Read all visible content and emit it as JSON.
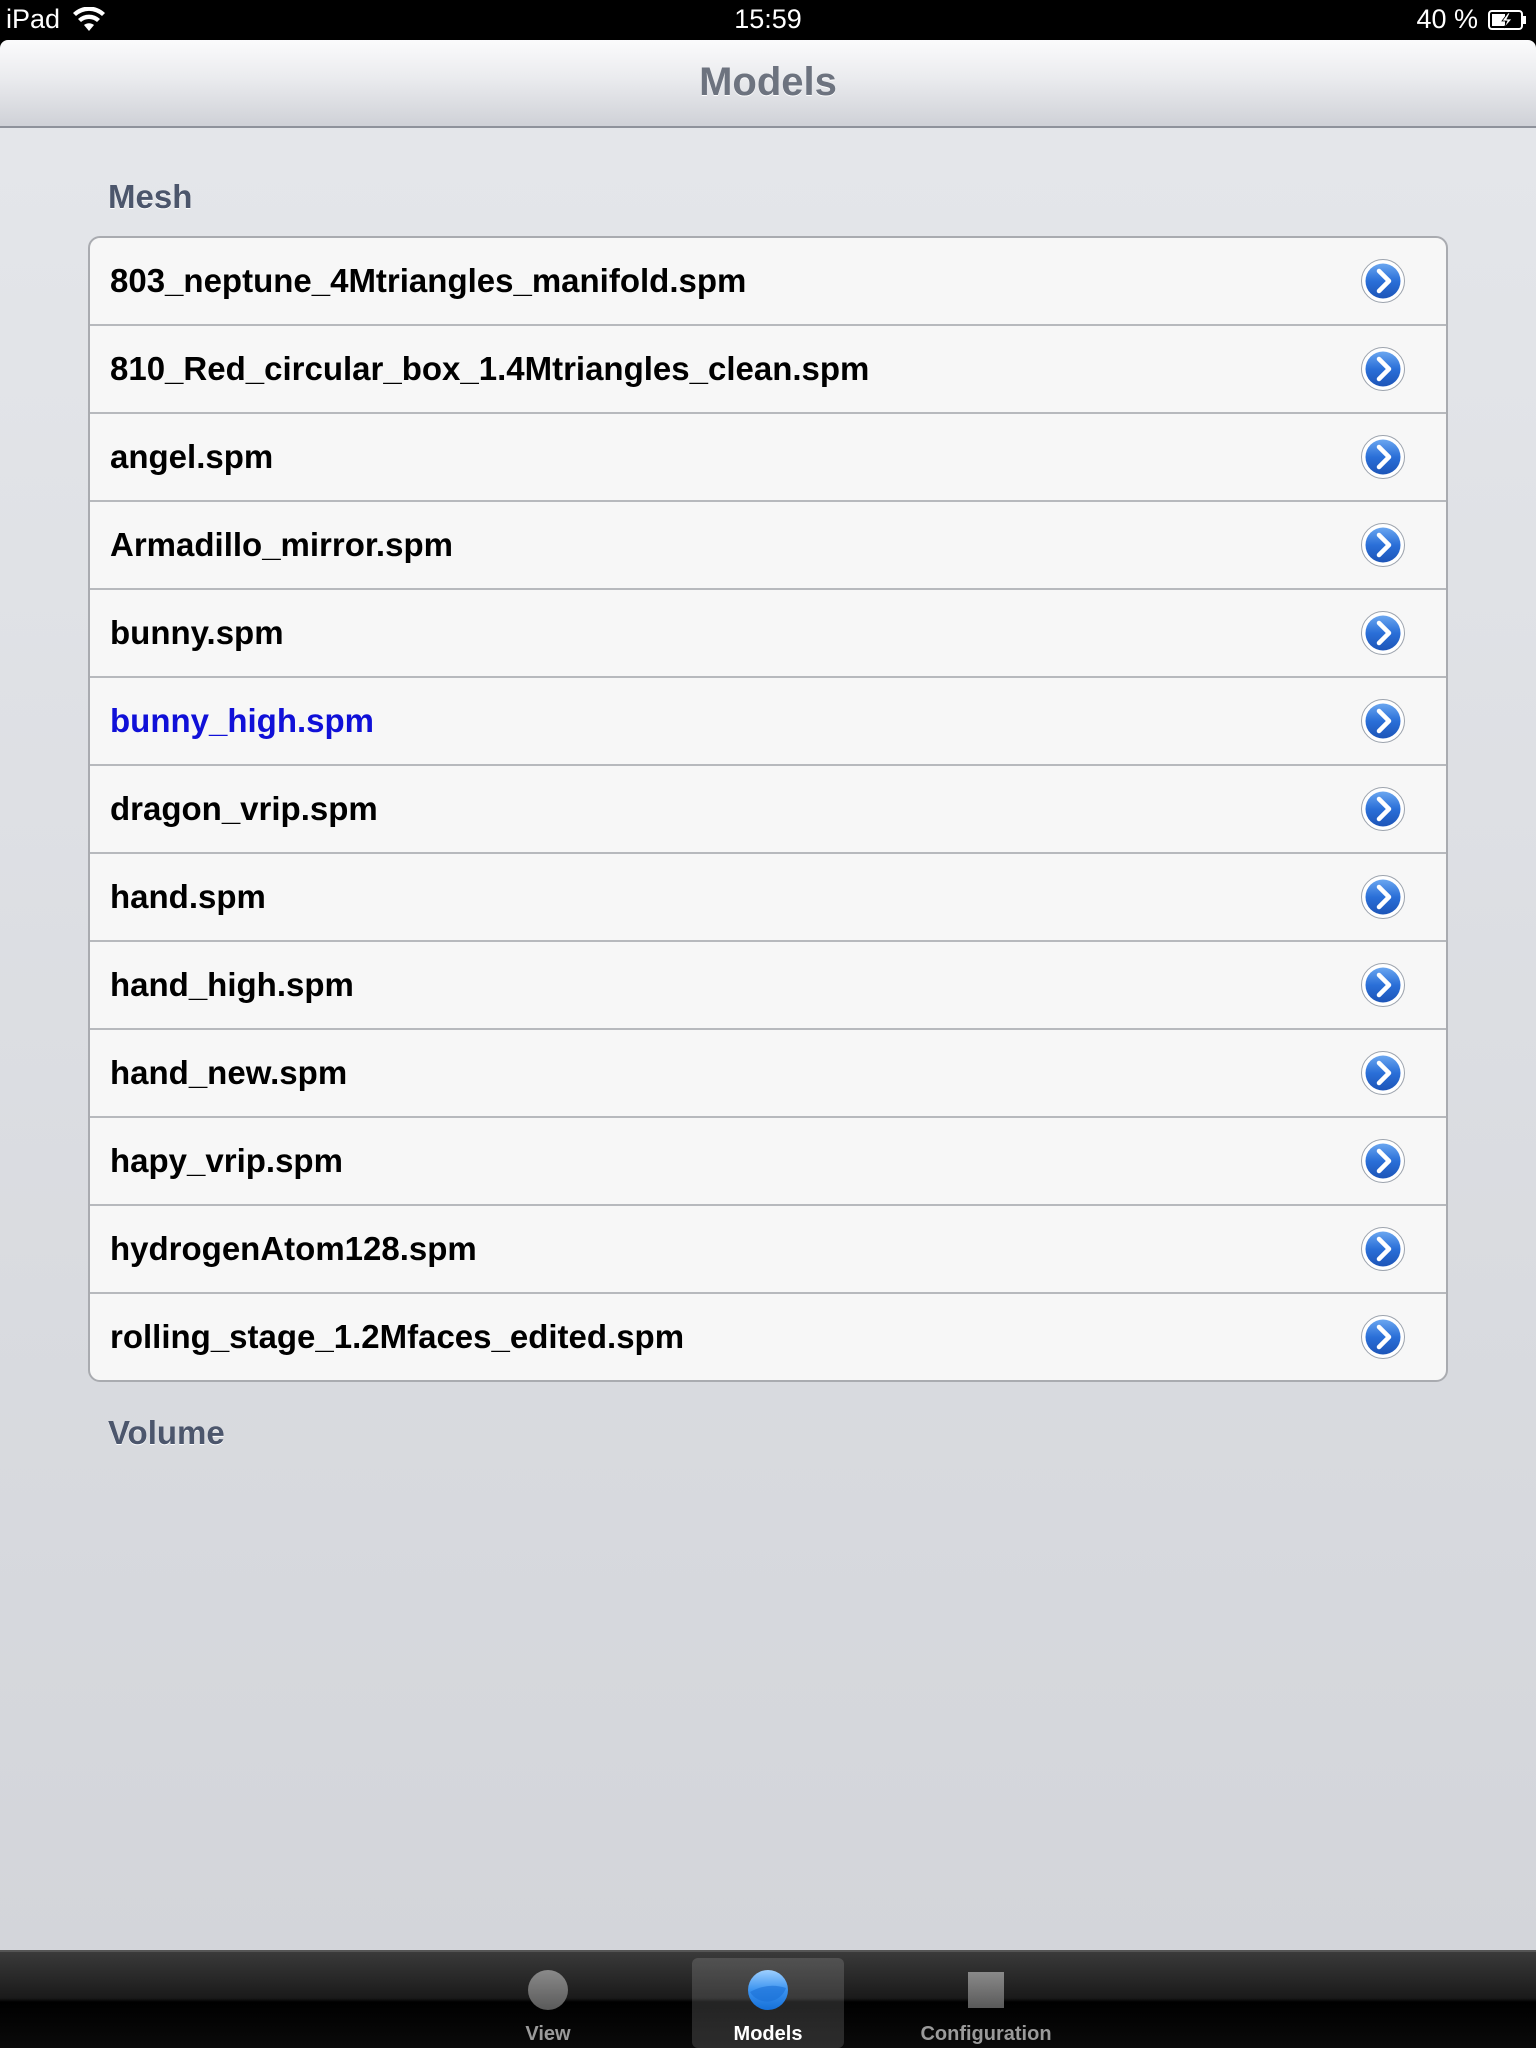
{
  "status_bar": {
    "device": "iPad",
    "time": "15:59",
    "battery": "40 %"
  },
  "nav_bar": {
    "title": "Models"
  },
  "sections": {
    "mesh": {
      "header": "Mesh",
      "items": [
        {
          "label": "803_neptune_4Mtriangles_manifold.spm"
        },
        {
          "label": "810_Red_circular_box_1.4Mtriangles_clean.spm"
        },
        {
          "label": "angel.spm"
        },
        {
          "label": "Armadillo_mirror.spm"
        },
        {
          "label": "bunny.spm"
        },
        {
          "label": "bunny_high.spm",
          "selected": true
        },
        {
          "label": "dragon_vrip.spm"
        },
        {
          "label": "hand.spm"
        },
        {
          "label": "hand_high.spm"
        },
        {
          "label": "hand_new.spm"
        },
        {
          "label": "hapy_vrip.spm"
        },
        {
          "label": "hydrogenAtom128.spm"
        },
        {
          "label": "rolling_stage_1.2Mfaces_edited.spm"
        }
      ]
    },
    "volume": {
      "header": "Volume"
    }
  },
  "tab_bar": {
    "tabs": [
      {
        "label": "View",
        "icon": "circle-icon"
      },
      {
        "label": "Models",
        "icon": "blue-circle-icon",
        "active": true
      },
      {
        "label": "Configuration",
        "icon": "square-icon"
      }
    ]
  },
  "colors": {
    "selected_text": "#1010d8",
    "disclosure_blue": "#2a6fd8",
    "section_header": "#4c566c"
  }
}
